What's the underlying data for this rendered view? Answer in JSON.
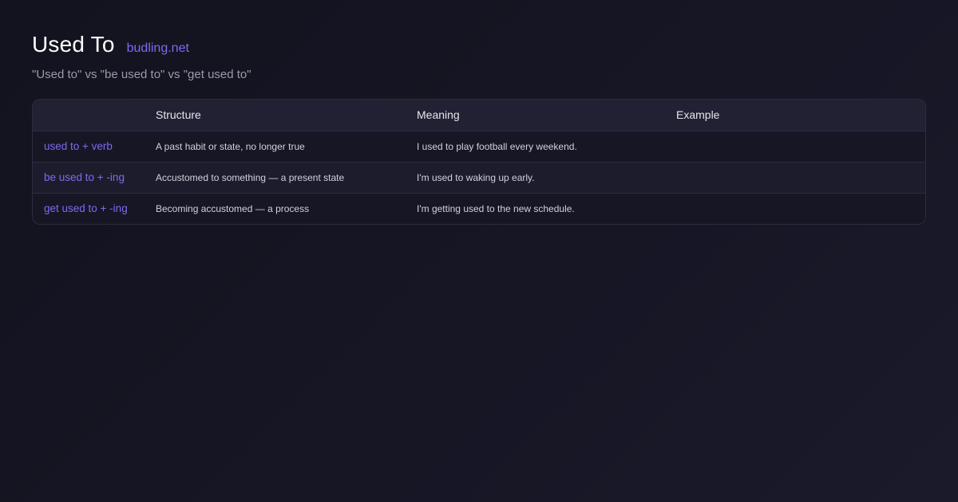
{
  "header": {
    "title": "Used To",
    "brand": "budling.net",
    "subtitle": "\"Used to\" vs \"be used to\" vs \"get used to\""
  },
  "table": {
    "columns": [
      "",
      "Structure",
      "Meaning",
      "Example"
    ],
    "rows": [
      {
        "term": "used to + verb",
        "structure": "A past habit or state, no longer true",
        "meaning": "I used to play football every weekend.",
        "example": ""
      },
      {
        "term": "be used to + -ing",
        "structure": "Accustomed to something — a present state",
        "meaning": "I'm used to waking up early.",
        "example": ""
      },
      {
        "term": "get used to + -ing",
        "structure": "Becoming accustomed — a process",
        "meaning": "I'm getting used to the new schedule.",
        "example": ""
      }
    ]
  },
  "colors": {
    "accent": "#7b6cf0",
    "background": "#13131f",
    "header_row": "#212133"
  }
}
